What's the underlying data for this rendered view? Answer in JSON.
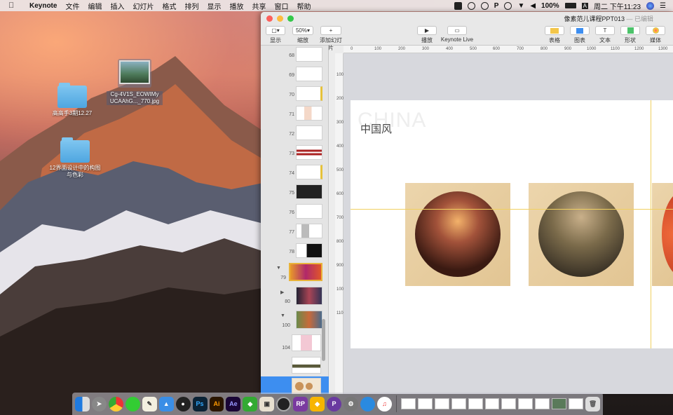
{
  "menubar": {
    "app_name": "Keynote",
    "items": [
      "文件",
      "编辑",
      "插入",
      "幻灯片",
      "格式",
      "排列",
      "显示",
      "播放",
      "共享",
      "窗口",
      "帮助"
    ],
    "battery": "100%",
    "clock": "周二 下午11:23"
  },
  "desktop": {
    "icons": [
      {
        "label": "Cg-4V1S_EOWIMy\nUCAAhG..._770.jpg",
        "type": "image"
      },
      {
        "label": "高高手3期12.27",
        "type": "folder"
      },
      {
        "label": "12界面设计中的构图\n与色彩",
        "type": "folder"
      }
    ]
  },
  "window": {
    "title": "像素范儿课程PPT013",
    "status": " — 已编辑",
    "toolbar": {
      "view": "显示",
      "zoom_value": "50%",
      "zoom": "缩放",
      "add_slide": "添加幻灯片",
      "play": "播放",
      "keynote_live": "Keynote Live",
      "table": "表格",
      "chart": "图表",
      "text": "文本",
      "shape": "形状",
      "media": "媒体"
    }
  },
  "sidebar": {
    "slides": [
      {
        "num": "68"
      },
      {
        "num": "69"
      },
      {
        "num": "70"
      },
      {
        "num": "71"
      },
      {
        "num": "72"
      },
      {
        "num": "73"
      },
      {
        "num": "74"
      },
      {
        "num": "75"
      },
      {
        "num": "76"
      },
      {
        "num": "77"
      },
      {
        "num": "78"
      },
      {
        "num": "79"
      },
      {
        "num": "80"
      },
      {
        "num": "100"
      },
      {
        "num": "104"
      }
    ]
  },
  "rulers": {
    "top": [
      "0",
      "100",
      "200",
      "300",
      "400",
      "500",
      "600",
      "700",
      "800",
      "900",
      "1000",
      "1100",
      "1200",
      "1300"
    ],
    "left": [
      "100",
      "200",
      "300",
      "400",
      "500",
      "600",
      "700",
      "800",
      "900",
      "1000",
      "1100"
    ]
  },
  "slide": {
    "ghost_text": "CHINA",
    "title": "中国风"
  },
  "colors": {
    "accent": "#3d8ef0",
    "card": "#e8cfa2",
    "guide": "#f0d060"
  }
}
